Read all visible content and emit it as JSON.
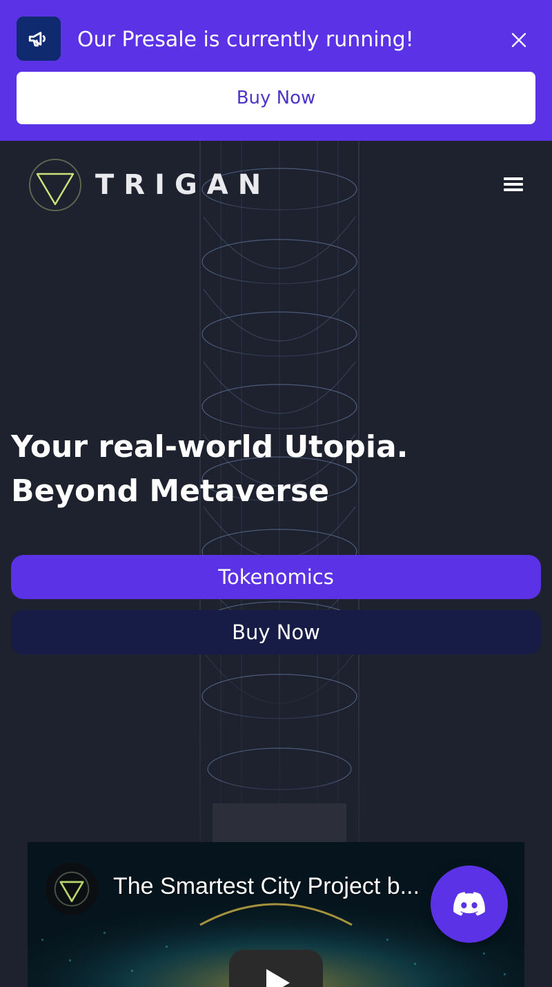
{
  "banner": {
    "message": "Our Presale is currently running!",
    "icon": "megaphone-icon",
    "close_icon": "close-icon",
    "buy_label": "Buy Now",
    "background_color": "#5b32e5"
  },
  "header": {
    "logo_text": "TRIGAN",
    "logo_icon": "triangle-logo-icon",
    "menu_icon": "hamburger-menu-icon"
  },
  "hero": {
    "headline_line1": "Your real-world Utopia.",
    "headline_line2": "Beyond Metaverse",
    "tokenomics_label": "Tokenomics",
    "buy_label": "Buy Now"
  },
  "video": {
    "title": "The Smartest City Project b...",
    "channel_icon": "triangle-logo-icon",
    "play_icon": "play-icon"
  },
  "discord": {
    "icon": "discord-icon"
  },
  "colors": {
    "accent": "#5b32e5",
    "navy_button": "#161c45",
    "page_background": "#1e212e"
  }
}
